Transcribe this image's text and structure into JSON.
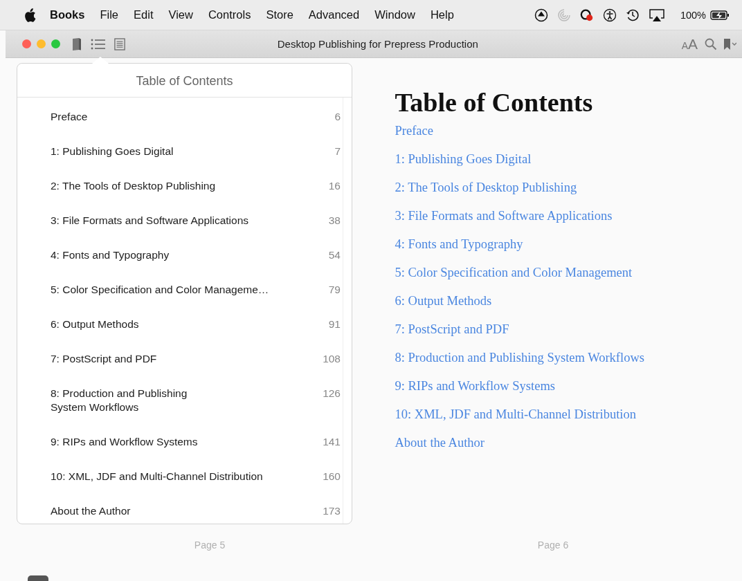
{
  "menu_bar": {
    "app_name": "Books",
    "items": [
      "File",
      "Edit",
      "View",
      "Controls",
      "Store",
      "Advanced",
      "Window",
      "Help"
    ],
    "battery": "100%"
  },
  "window": {
    "title": "Desktop Publishing for Prepress Production",
    "tools": [
      {
        "kind": "book"
      },
      {
        "kind": "contents"
      },
      {
        "kind": "notes"
      }
    ],
    "font_button": [
      "A",
      "A"
    ]
  },
  "toc_popover": {
    "title": "Table of Contents",
    "entries": [
      {
        "title": "Preface",
        "page": "6"
      },
      {
        "title": "1: Publishing Goes Digital",
        "page": "7"
      },
      {
        "title": "2: The Tools of Desktop Publishing",
        "page": "16"
      },
      {
        "title": "3: File Formats and Software Applications",
        "page": "38"
      },
      {
        "title": "4: Fonts and Typography",
        "page": "54"
      },
      {
        "title": "5: Color Specification and Color Manageme…",
        "page": "79"
      },
      {
        "title": "6: Output Methods",
        "page": "91"
      },
      {
        "title": "7: PostScript and PDF",
        "page": "108"
      },
      {
        "title": "8: Production and Publishing\nSystem Workflows",
        "page": "126"
      },
      {
        "title": "9: RIPs and Workflow Systems",
        "page": "141"
      },
      {
        "title": "10: XML, JDF and Multi-Channel Distribution",
        "page": "160"
      },
      {
        "title": "About the Author",
        "page": "173"
      }
    ]
  },
  "page": {
    "heading": "Table of Contents",
    "links": [
      "Preface",
      "1: Publishing Goes Digital",
      "2: The Tools of Desktop Publishing",
      "3: File Formats and Software Applications",
      "4: Fonts and Typography",
      "5: Color Specification and Color Management",
      "6: Output Methods",
      "7: PostScript and PDF",
      "8: Production and Publishing System Workflows",
      "9: RIPs and Workflow Systems",
      "10: XML, JDF and Multi-Channel Distribution",
      "About the Author"
    ]
  },
  "page_numbers": [
    "Page 5",
    "Page 6"
  ]
}
